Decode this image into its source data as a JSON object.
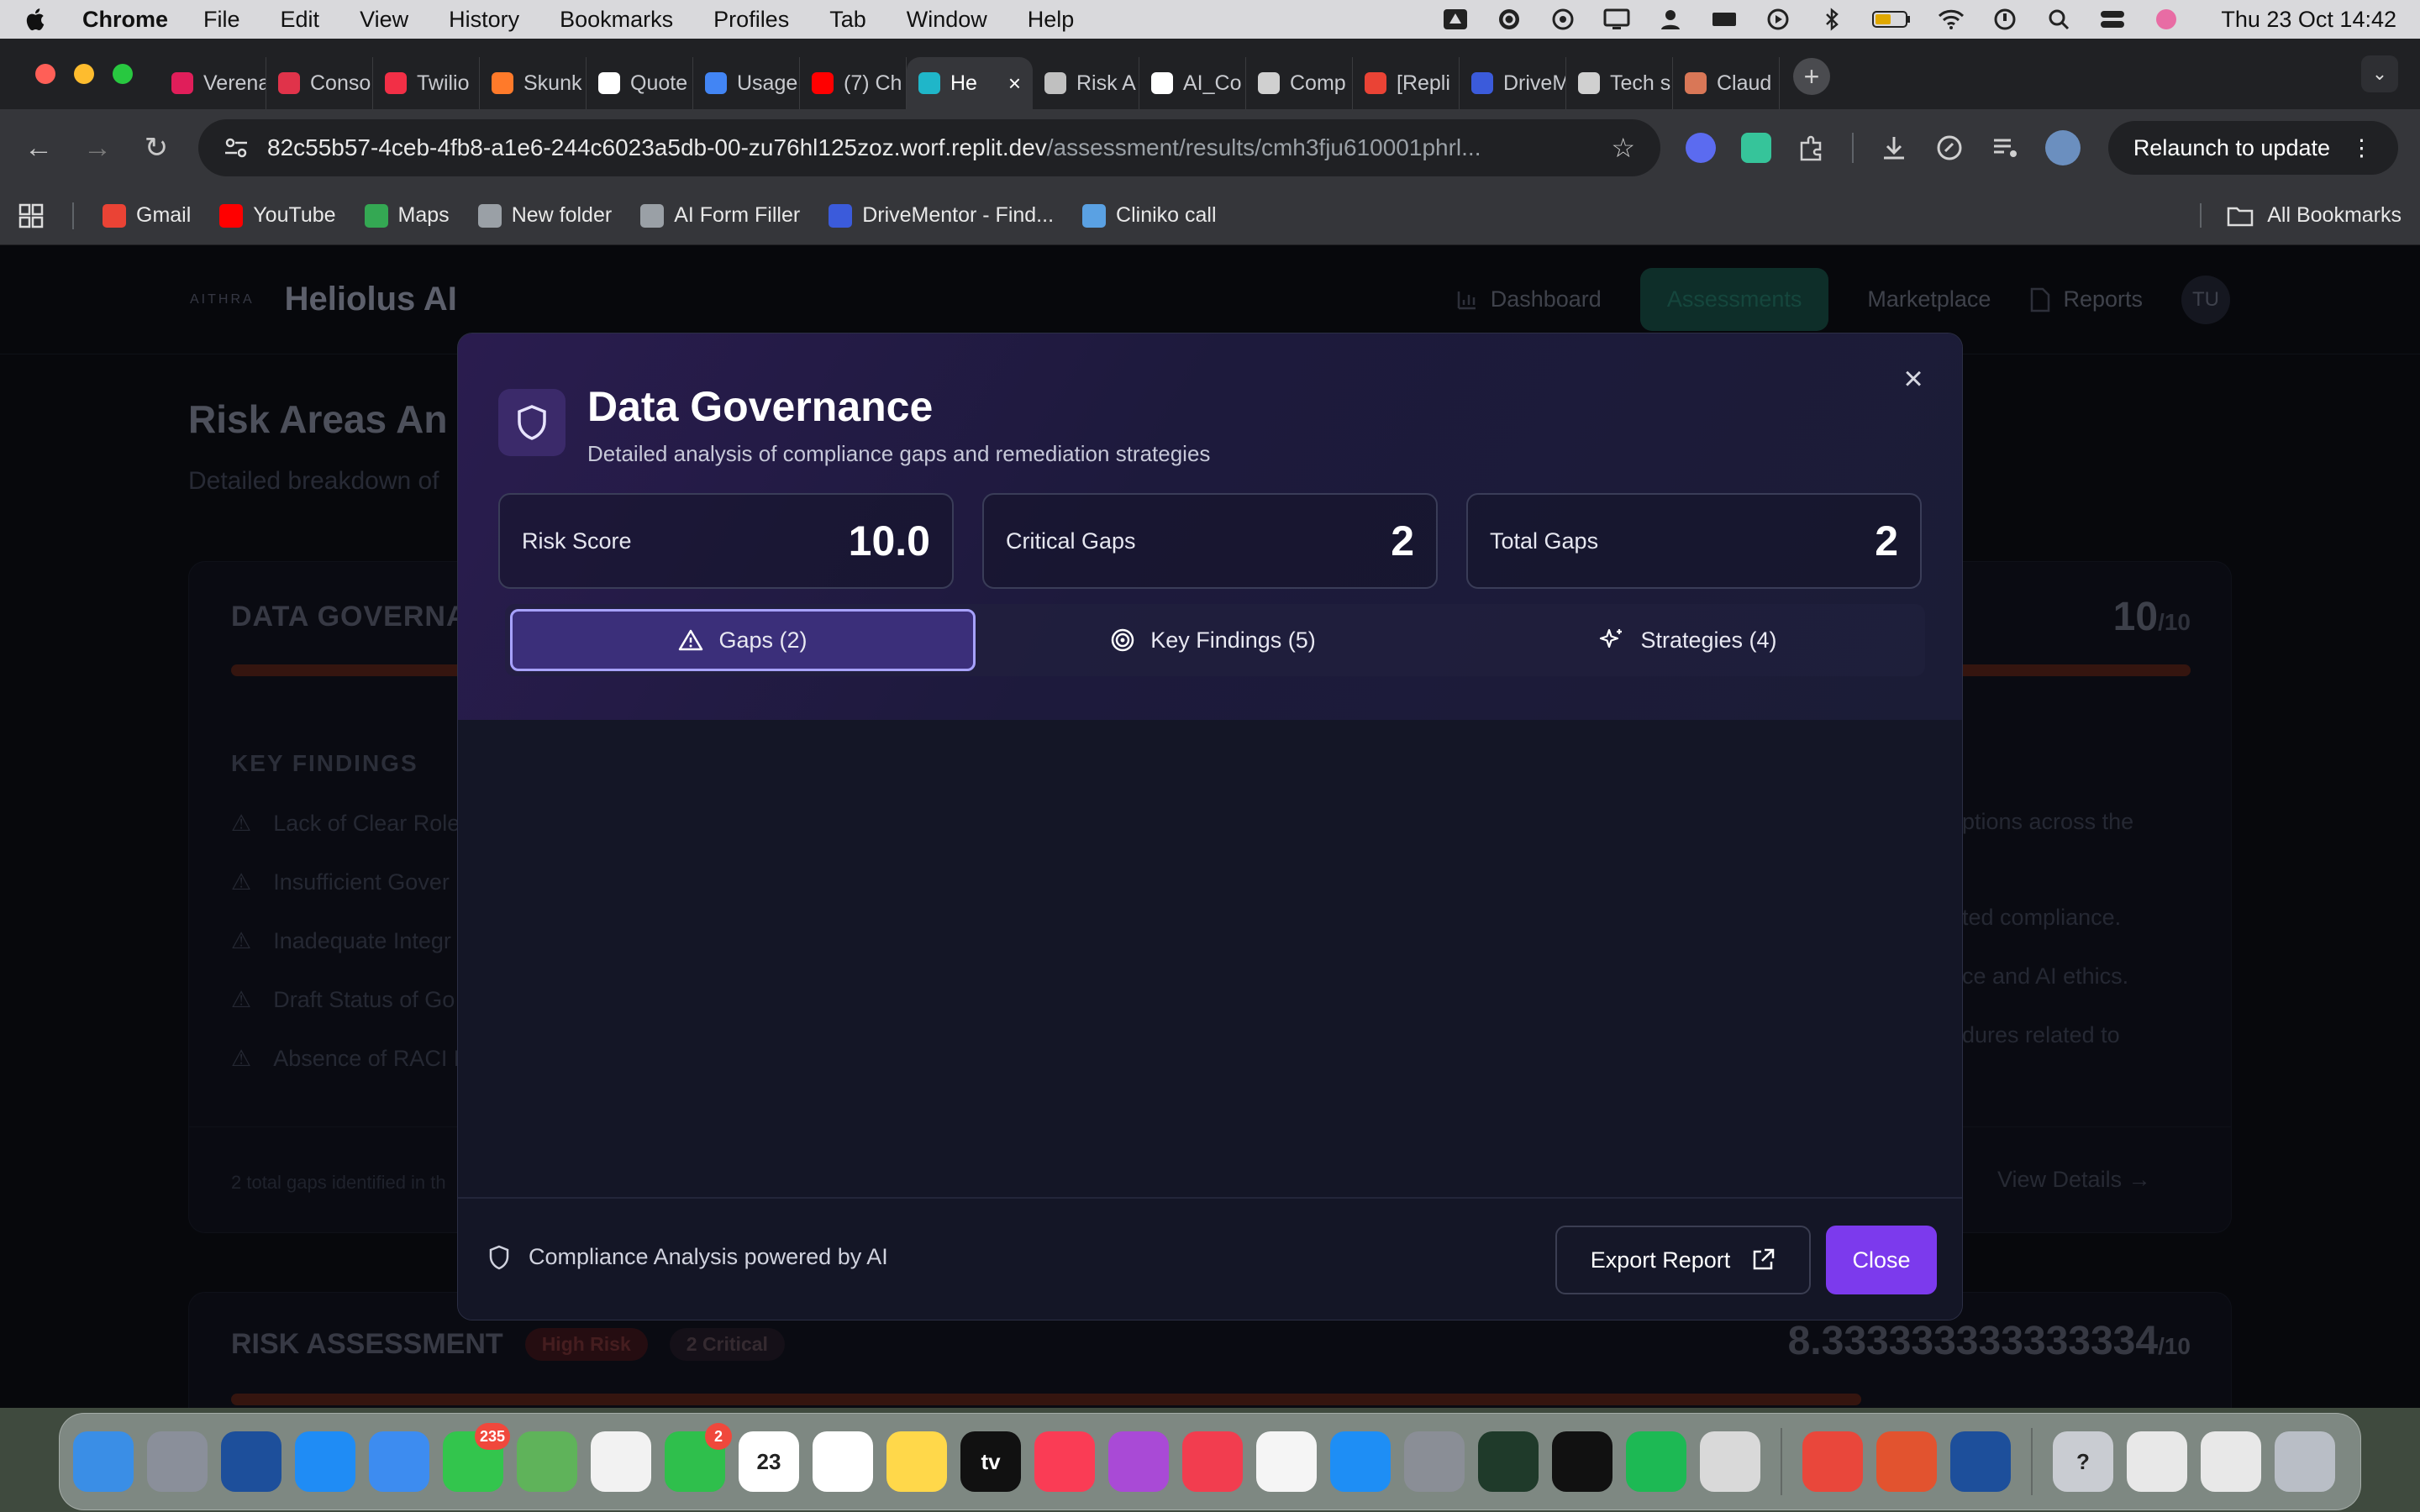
{
  "menubar": {
    "app": "Chrome",
    "items": [
      "File",
      "Edit",
      "View",
      "History",
      "Bookmarks",
      "Profiles",
      "Tab",
      "Window",
      "Help"
    ],
    "clock": "Thu 23 Oct  14:42"
  },
  "tabs": [
    {
      "label": "Verena",
      "color": "#e01e5a"
    },
    {
      "label": "Conso",
      "color": "#e0334a"
    },
    {
      "label": "Twilio",
      "color": "#f22f46"
    },
    {
      "label": "Skunk",
      "color": "#ff7a2a"
    },
    {
      "label": "Quote",
      "color": "#ffffff"
    },
    {
      "label": "Usage",
      "color": "#4285f4"
    },
    {
      "label": "(7) Ch",
      "color": "#ff0000"
    },
    {
      "label": "He",
      "color": "#1fb6c9",
      "active": true
    },
    {
      "label": "Risk A",
      "color": "#c0c0c0"
    },
    {
      "label": "AI_Co",
      "color": "#ffffff"
    },
    {
      "label": "Comp",
      "color": "#d0d0d0"
    },
    {
      "label": "[Repli",
      "color": "#ea4335"
    },
    {
      "label": "DriveM",
      "color": "#3b5bdb"
    },
    {
      "label": "Tech s",
      "color": "#d0d0d0"
    },
    {
      "label": "Claud",
      "color": "#d97757"
    }
  ],
  "toolbar": {
    "url_host": "82c55b57-4ceb-4fb8-a1e6-244c6023a5db-00-zu76hl125zoz.worf.replit.dev",
    "url_path": "/assessment/results/cmh3fju610001phrl...",
    "relaunch_label": "Relaunch to update"
  },
  "bookmarks": {
    "items": [
      {
        "label": "Gmail",
        "color": "#ea4335"
      },
      {
        "label": "YouTube",
        "color": "#ff0000"
      },
      {
        "label": "Maps",
        "color": "#34a853"
      },
      {
        "label": "New folder",
        "color": "#9aa0a6"
      },
      {
        "label": "AI Form Filler",
        "color": "#9aa0a6"
      },
      {
        "label": "DriveMentor - Find...",
        "color": "#3b5bdb"
      },
      {
        "label": "Cliniko call",
        "color": "#5aa1e3"
      }
    ],
    "all_label": "All Bookmarks"
  },
  "app": {
    "logo_text": "AITHRA",
    "name": "Heliolus AI",
    "nav": [
      "Dashboard",
      "Assessments",
      "Marketplace",
      "Reports"
    ],
    "avatar": "TU",
    "page_title": "Risk Areas An",
    "page_subtitle": "Detailed breakdown of",
    "card1": {
      "title": "DATA GOVERNA",
      "score": "10",
      "score_of": "/10",
      "findings_heading": "KEY FINDINGS",
      "findings": [
        "Lack of Clear Role",
        "Insufficient Gover",
        "Inadequate Integr",
        "Draft Status of Go",
        "Absence of RACI M"
      ],
      "right_texts": [
        "riptions across the",
        "ated compliance.",
        "nce and AI ethics.",
        "edures related to"
      ],
      "footer_left": "2 total gaps identified in th",
      "footer_right": "View Details"
    },
    "card2": {
      "title": "RISK ASSESSMENT",
      "pill1": "High Risk",
      "pill2": "2 Critical",
      "score": "8.333333333333334",
      "score_of": "/10"
    }
  },
  "modal": {
    "title": "Data Governance",
    "subtitle": "Detailed analysis of compliance gaps and remediation strategies",
    "stats": [
      {
        "label": "Risk Score",
        "value": "10.0"
      },
      {
        "label": "Critical Gaps",
        "value": "2"
      },
      {
        "label": "Total Gaps",
        "value": "2"
      }
    ],
    "tabs": [
      {
        "label": "Gaps (2)",
        "icon": "warning-icon",
        "active": true
      },
      {
        "label": "Key Findings (5)",
        "icon": "target-icon"
      },
      {
        "label": "Strategies (4)",
        "icon": "sparkles-icon"
      }
    ],
    "footer_note": "Compliance Analysis powered by AI",
    "export_label": "Export Report",
    "close_label": "Close",
    "accent": "#7c3aed"
  },
  "dock": [
    {
      "name": "finder",
      "color": "#3a8ee6"
    },
    {
      "name": "launchpad",
      "color": "#8a8f9a"
    },
    {
      "name": "app-blue",
      "color": "#1d4f9b"
    },
    {
      "name": "safari",
      "color": "#1f8cf5"
    },
    {
      "name": "mail",
      "color": "#3d8cf0"
    },
    {
      "name": "messages",
      "color": "#33c54d",
      "badge": "235"
    },
    {
      "name": "maps",
      "color": "#5fb35a"
    },
    {
      "name": "photos",
      "color": "#f2f2f2"
    },
    {
      "name": "facetime",
      "color": "#2fbf4c",
      "badge": "2"
    },
    {
      "name": "calendar",
      "color": "#ffffff",
      "text": "23"
    },
    {
      "name": "reminders",
      "color": "#ffffff"
    },
    {
      "name": "notes",
      "color": "#ffd84a"
    },
    {
      "name": "tv",
      "color": "#111111",
      "text": "tv"
    },
    {
      "name": "music",
      "color": "#fa3c55"
    },
    {
      "name": "podcasts",
      "color": "#a94ad6"
    },
    {
      "name": "news",
      "color": "#f23d4f"
    },
    {
      "name": "freeform",
      "color": "#f5f5f5"
    },
    {
      "name": "app-store",
      "color": "#1e8ef5"
    },
    {
      "name": "settings",
      "color": "#8a8e96"
    },
    {
      "name": "music-app",
      "color": "#1f3a2a"
    },
    {
      "name": "app-black",
      "color": "#111111"
    },
    {
      "name": "spotify",
      "color": "#1db954"
    },
    {
      "name": "iphone-mirroring",
      "color": "#d9d9d9"
    },
    {
      "name": "chrome",
      "color": "#e9473b"
    },
    {
      "name": "app-orange",
      "color": "#e2532f"
    },
    {
      "name": "app-blue2",
      "color": "#1d4f9b"
    },
    {
      "name": "help",
      "color": "#c9ccd2",
      "text": "?"
    },
    {
      "name": "document",
      "color": "#e8e8e8"
    },
    {
      "name": "window",
      "color": "#e8e8e8"
    },
    {
      "name": "trash",
      "color": "#b9bec6"
    }
  ]
}
